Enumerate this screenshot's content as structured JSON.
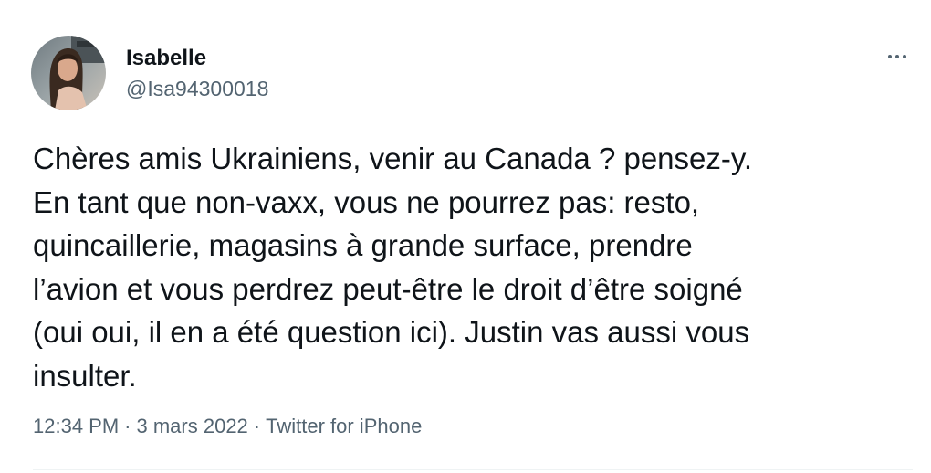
{
  "tweet": {
    "author": {
      "display_name": "Isabelle",
      "handle": "@Isa94300018",
      "avatar_icon": "profile-photo"
    },
    "text": "Chères amis Ukrainiens, venir au Canada ? pensez-y.\nEn tant que non-vaxx, vous ne pourrez pas: resto,\nquincaillerie, magasins à grande surface, prendre\nl’avion et vous perdrez peut-être le droit d’être soigné\n(oui oui, il en a été question ici). Justin vas aussi vous\ninsulter.",
    "time": "12:34 PM",
    "date": "3 mars 2022",
    "source": "Twitter for iPhone",
    "separator": "·",
    "more_icon": "more-horizontal-icon"
  },
  "colors": {
    "text_primary": "#0f1419",
    "text_secondary": "#536471",
    "divider": "#eff3f4",
    "background": "#ffffff"
  }
}
